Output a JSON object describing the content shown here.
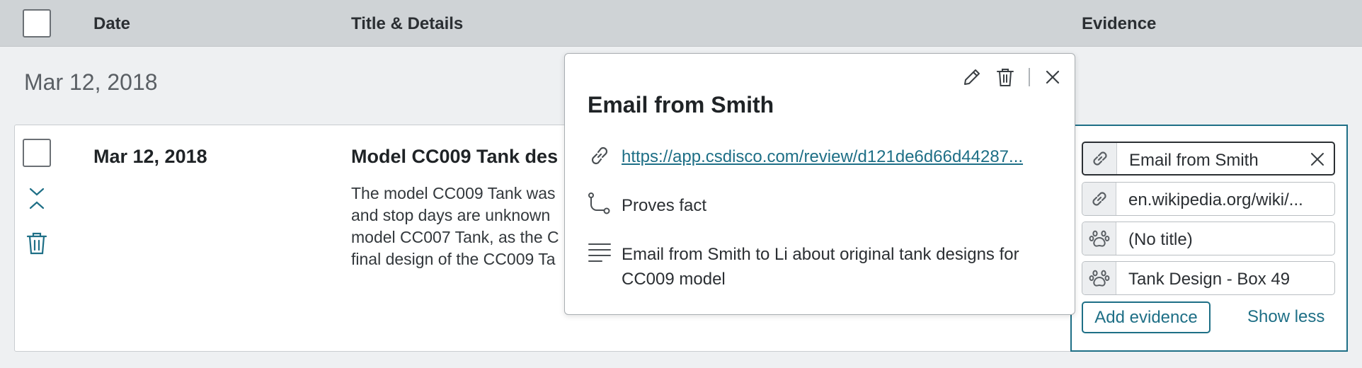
{
  "header": {
    "date_label": "Date",
    "title_label": "Title & Details",
    "evidence_label": "Evidence"
  },
  "group": {
    "date": "Mar 12, 2018"
  },
  "row": {
    "date": "Mar 12, 2018",
    "title": "Model CC009 Tank des",
    "description_lines": [
      "The model CC009 Tank was",
      "and stop days are unknown",
      "model CC007 Tank, as the C",
      "final design of the CC009 Ta"
    ]
  },
  "popover": {
    "title": "Email from Smith",
    "link": "https://app.csdisco.com/review/d121de6d66d44287...",
    "relation": "Proves fact",
    "description_lines": [
      "Email from Smith to Li about original tank designs for",
      "CC009 model"
    ]
  },
  "evidence": {
    "items": [
      {
        "label": "Email from Smith",
        "icon": "link-icon"
      },
      {
        "label": "en.wikipedia.org/wiki/...",
        "icon": "link-icon"
      },
      {
        "label": "(No title)",
        "icon": "paw-icon"
      },
      {
        "label": "Tank Design - Box 49",
        "icon": "paw-icon"
      }
    ],
    "add_label": "Add evidence",
    "show_less_label": "Show less"
  },
  "colors": {
    "accent": "#1e6f86",
    "header_bg": "#cfd3d6",
    "page_bg": "#eef0f2"
  }
}
